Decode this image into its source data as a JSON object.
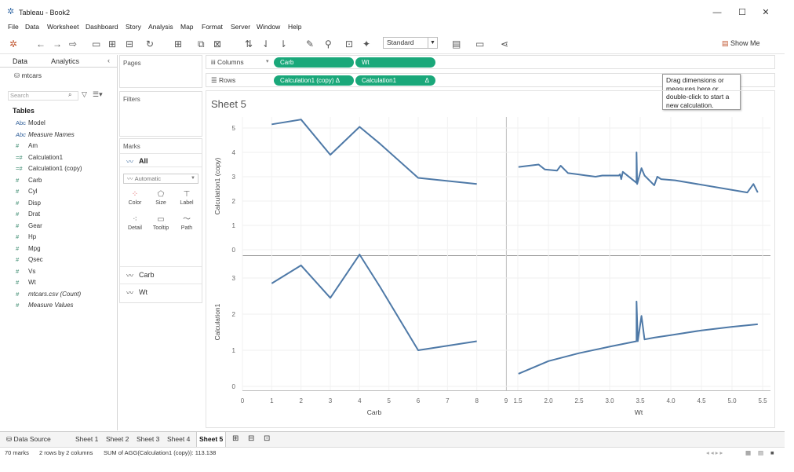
{
  "window": {
    "title": "Tableau - Book2"
  },
  "menu": [
    "File",
    "Data",
    "Worksheet",
    "Dashboard",
    "Story",
    "Analysis",
    "Map",
    "Format",
    "Server",
    "Window",
    "Help"
  ],
  "toolbar": {
    "fit_dropdown": "Standard",
    "show_me": "Show Me"
  },
  "left_pane": {
    "tabs": [
      "Data",
      "Analytics"
    ],
    "datasource": "mtcars",
    "search_placeholder": "Search",
    "tables_header": "Tables",
    "fields": [
      {
        "name": "Model",
        "type": "Abc",
        "italic": false
      },
      {
        "name": "Measure Names",
        "type": "Abc",
        "italic": true
      },
      {
        "name": "Am",
        "type": "#",
        "italic": false
      },
      {
        "name": "Calculation1",
        "type": "=#",
        "italic": false
      },
      {
        "name": "Calculation1 (copy)",
        "type": "=#",
        "italic": false
      },
      {
        "name": "Carb",
        "type": "#",
        "italic": false
      },
      {
        "name": "Cyl",
        "type": "#",
        "italic": false
      },
      {
        "name": "Disp",
        "type": "#",
        "italic": false
      },
      {
        "name": "Drat",
        "type": "#",
        "italic": false
      },
      {
        "name": "Gear",
        "type": "#",
        "italic": false
      },
      {
        "name": "Hp",
        "type": "#",
        "italic": false
      },
      {
        "name": "Mpg",
        "type": "#",
        "italic": false
      },
      {
        "name": "Qsec",
        "type": "#",
        "italic": false
      },
      {
        "name": "Vs",
        "type": "#",
        "italic": false
      },
      {
        "name": "Wt",
        "type": "#",
        "italic": false
      },
      {
        "name": "mtcars.csv (Count)",
        "type": "#",
        "italic": true
      },
      {
        "name": "Measure Values",
        "type": "#",
        "italic": true
      }
    ]
  },
  "cards": {
    "pages": "Pages",
    "filters": "Filters",
    "marks": "Marks",
    "marks_all": "All",
    "mark_type": "Automatic",
    "mark_buttons": [
      "Color",
      "Size",
      "Label",
      "Detail",
      "Tooltip",
      "Path"
    ],
    "mark_sections": [
      "Carb",
      "Wt"
    ]
  },
  "shelves": {
    "columns_label": "Columns",
    "rows_label": "Rows",
    "columns_pills": [
      "Carb",
      "Wt"
    ],
    "rows_pills": [
      "Calculation1 (copy)",
      "Calculation1"
    ]
  },
  "tooltip": "Drag dimensions or measures here or double-click to start a new calculation.",
  "sheet_title": "Sheet 5",
  "bottom_tabs": [
    "Data Source",
    "Sheet 1",
    "Sheet 2",
    "Sheet 3",
    "Sheet 4",
    "Sheet 5"
  ],
  "active_tab": "Sheet 5",
  "status": {
    "marks": "70 marks",
    "dims": "2 rows by 2 columns",
    "sum": "SUM of AGG(Calculation1 (copy)): 113.138"
  },
  "colors": {
    "line": "#4e79a7",
    "pill": "#1aa87a"
  },
  "chart_data": {
    "type": "line",
    "columns": [
      "Carb",
      "Wt"
    ],
    "rows": [
      "Calculation1 (copy)",
      "Calculation1"
    ],
    "x_axes": [
      {
        "label": "Carb",
        "ticks": [
          0,
          1,
          2,
          3,
          4,
          5,
          6,
          7,
          8,
          9
        ],
        "range": [
          0,
          9
        ]
      },
      {
        "label": "Wt",
        "ticks": [
          1.5,
          2.0,
          2.5,
          3.0,
          3.5,
          4.0,
          4.5,
          5.0,
          5.5
        ],
        "range": [
          1.4,
          5.5
        ]
      }
    ],
    "y_axes": [
      {
        "label": "Calculation1 (copy)",
        "ticks": [
          0,
          1,
          2,
          3,
          4,
          5
        ],
        "range": [
          0,
          5.5
        ]
      },
      {
        "label": "Calculation1",
        "ticks": [
          0,
          1,
          2,
          3
        ],
        "range": [
          0,
          3.7
        ]
      }
    ],
    "panes": [
      {
        "row": 0,
        "col": 0,
        "x": [
          1,
          2,
          3,
          4,
          4.7,
          6,
          8
        ],
        "y": [
          5.15,
          5.35,
          3.9,
          5.05,
          4.35,
          2.95,
          2.7
        ]
      },
      {
        "row": 0,
        "col": 1,
        "x": [
          1.51,
          1.84,
          1.94,
          2.14,
          2.2,
          2.32,
          2.47,
          2.62,
          2.77,
          2.88,
          3.15,
          3.17,
          3.19,
          3.215,
          3.44,
          3.44,
          3.45,
          3.52,
          3.57,
          3.73,
          3.78,
          3.84,
          4.07,
          5.25,
          5.35,
          5.42
        ],
        "y": [
          3.4,
          3.5,
          3.3,
          3.25,
          3.45,
          3.15,
          3.1,
          3.05,
          3.0,
          3.05,
          3.05,
          3.1,
          2.9,
          3.2,
          2.75,
          4.0,
          2.7,
          3.35,
          3.05,
          2.65,
          3.0,
          2.9,
          2.85,
          2.35,
          2.7,
          2.35
        ]
      },
      {
        "row": 1,
        "col": 0,
        "x": [
          1,
          2,
          3,
          4,
          4.7,
          6,
          8
        ],
        "y": [
          2.85,
          3.35,
          2.45,
          3.65,
          2.75,
          1.0,
          1.25
        ]
      },
      {
        "row": 1,
        "col": 1,
        "x": [
          1.51,
          2.0,
          2.5,
          3.0,
          3.44,
          3.44,
          3.46,
          3.52,
          3.57,
          3.73,
          4.0,
          4.5,
          5.0,
          5.42
        ],
        "y": [
          0.35,
          0.7,
          0.92,
          1.1,
          1.25,
          2.35,
          1.25,
          1.95,
          1.3,
          1.35,
          1.42,
          1.55,
          1.65,
          1.72
        ]
      }
    ]
  }
}
